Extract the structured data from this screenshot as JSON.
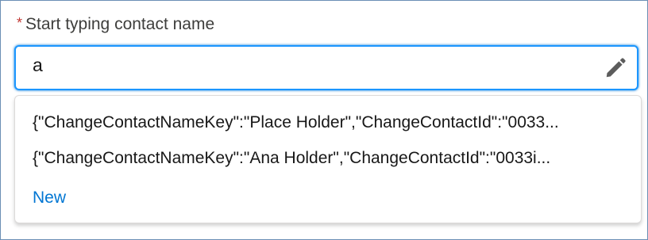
{
  "field": {
    "required_marker": "*",
    "label": "Start typing contact name",
    "value": "a"
  },
  "icons": {
    "edit": "pencil-icon"
  },
  "dropdown": {
    "options": [
      "{\"ChangeContactNameKey\":\"Place Holder\",\"ChangeContactId\":\"0033...",
      "{\"ChangeContactNameKey\":\"Ana Holder\",\"ChangeContactId\":\"0033i..."
    ],
    "new_label": "New"
  },
  "colors": {
    "focus_border": "#1b96ff",
    "link": "#0176d3",
    "required": "#c23934"
  }
}
